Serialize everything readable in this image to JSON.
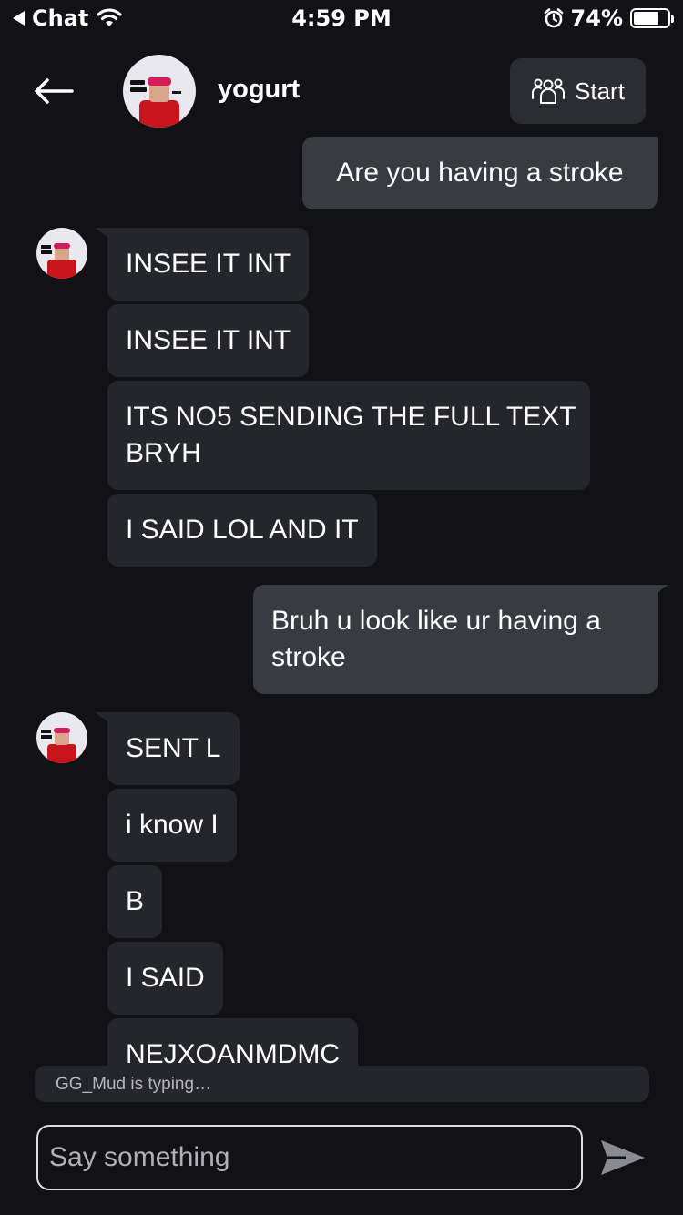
{
  "status_bar": {
    "back_app": "Chat",
    "time": "4:59 PM",
    "battery": "74%",
    "battery_level": 0.74
  },
  "header": {
    "name": "yogurt",
    "start_label": "Start"
  },
  "messages": [
    {
      "direction": "outgoing",
      "text": "Are you having a stroke"
    },
    {
      "direction": "incoming",
      "text": "INSEE IT INT"
    },
    {
      "direction": "incoming",
      "text": "INSEE IT INT"
    },
    {
      "direction": "incoming",
      "text_lines": [
        "ITS NO5 SENDING THE FULL TEXT",
        "BRYH"
      ]
    },
    {
      "direction": "incoming",
      "text": "I SAID LOL AND IT"
    },
    {
      "direction": "outgoing",
      "text_lines": [
        "Bruh u look like ur having a",
        "stroke"
      ]
    },
    {
      "direction": "incoming",
      "text": "SENT L"
    },
    {
      "direction": "incoming",
      "text": "i know I"
    },
    {
      "direction": "incoming",
      "text": "B"
    },
    {
      "direction": "incoming",
      "text": "I SAID"
    },
    {
      "direction": "incoming",
      "text": "NEJXOANMDMC"
    }
  ],
  "typing_indicator": "GG_Mud is typing…",
  "composer": {
    "placeholder": "Say something"
  },
  "icons": {
    "status_back": "back-triangle-icon",
    "wifi": "wifi-icon",
    "alarm": "alarm-icon",
    "battery": "battery-icon",
    "back": "arrow-left-icon",
    "start": "people-group-icon",
    "send": "send-icon"
  }
}
